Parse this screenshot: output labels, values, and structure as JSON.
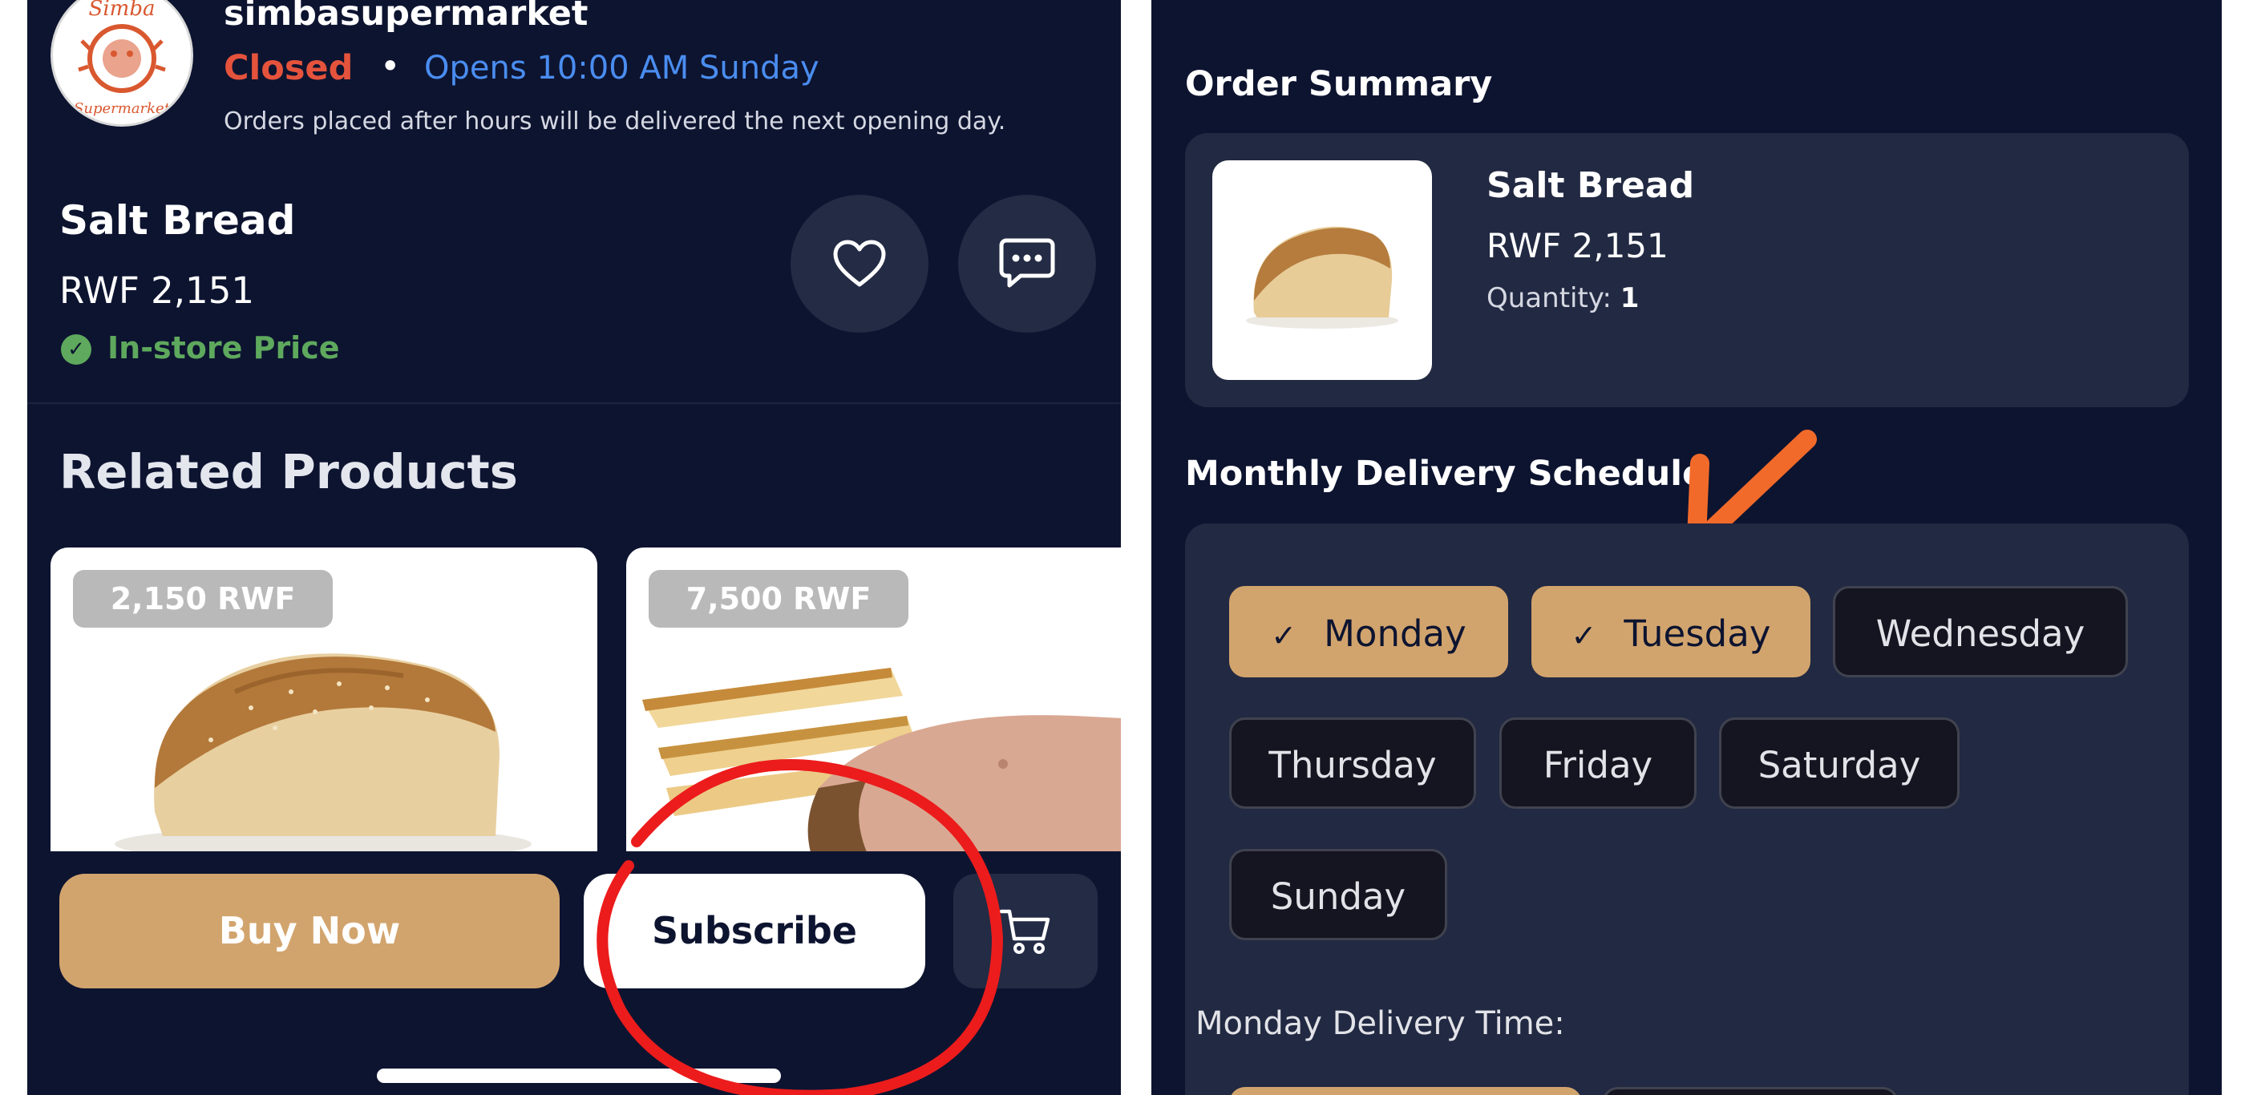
{
  "store": {
    "name": "simbasupermarket",
    "logo_text_top": "Simba",
    "logo_text_bottom": "Supermarket",
    "status": "Closed",
    "separator": "•",
    "opens": "Opens 10:00 AM Sunday",
    "note": "Orders placed after hours will be delivered the next opening day."
  },
  "product": {
    "name": "Salt Bread",
    "price": "RWF 2,151",
    "price_badge": "In-store Price",
    "icons": {
      "favorite": "heart-icon",
      "chat": "chat-bubble-icon",
      "badge": "check-circle-icon"
    }
  },
  "related": {
    "title": "Related Products",
    "items": [
      {
        "price": "2,150 RWF"
      },
      {
        "price": "7,500 RWF"
      }
    ]
  },
  "actions": {
    "buy_now": "Buy Now",
    "subscribe": "Subscribe",
    "cart_icon": "cart-icon"
  },
  "order_summary": {
    "title": "Order Summary",
    "name": "Salt Bread",
    "price": "RWF 2,151",
    "quantity_label": "Quantity:",
    "quantity": "1"
  },
  "schedule": {
    "title": "Monthly Delivery Schedule",
    "days": [
      {
        "label": "Monday",
        "selected": true
      },
      {
        "label": "Tuesday",
        "selected": true
      },
      {
        "label": "Wednesday",
        "selected": false
      },
      {
        "label": "Thursday",
        "selected": false
      },
      {
        "label": "Friday",
        "selected": false
      },
      {
        "label": "Saturday",
        "selected": false
      },
      {
        "label": "Sunday",
        "selected": false
      }
    ],
    "check_mark": "✓",
    "delivery_time_label": "Monday Delivery Time:"
  },
  "colors": {
    "background": "#0d1430",
    "card": "#222942",
    "accent": "#d2a46d",
    "closed": "#e5533c",
    "opens": "#4a8df0",
    "instore": "#5ea95d",
    "annotation_red": "#ec1c1c",
    "annotation_orange": "#f26a2a"
  }
}
